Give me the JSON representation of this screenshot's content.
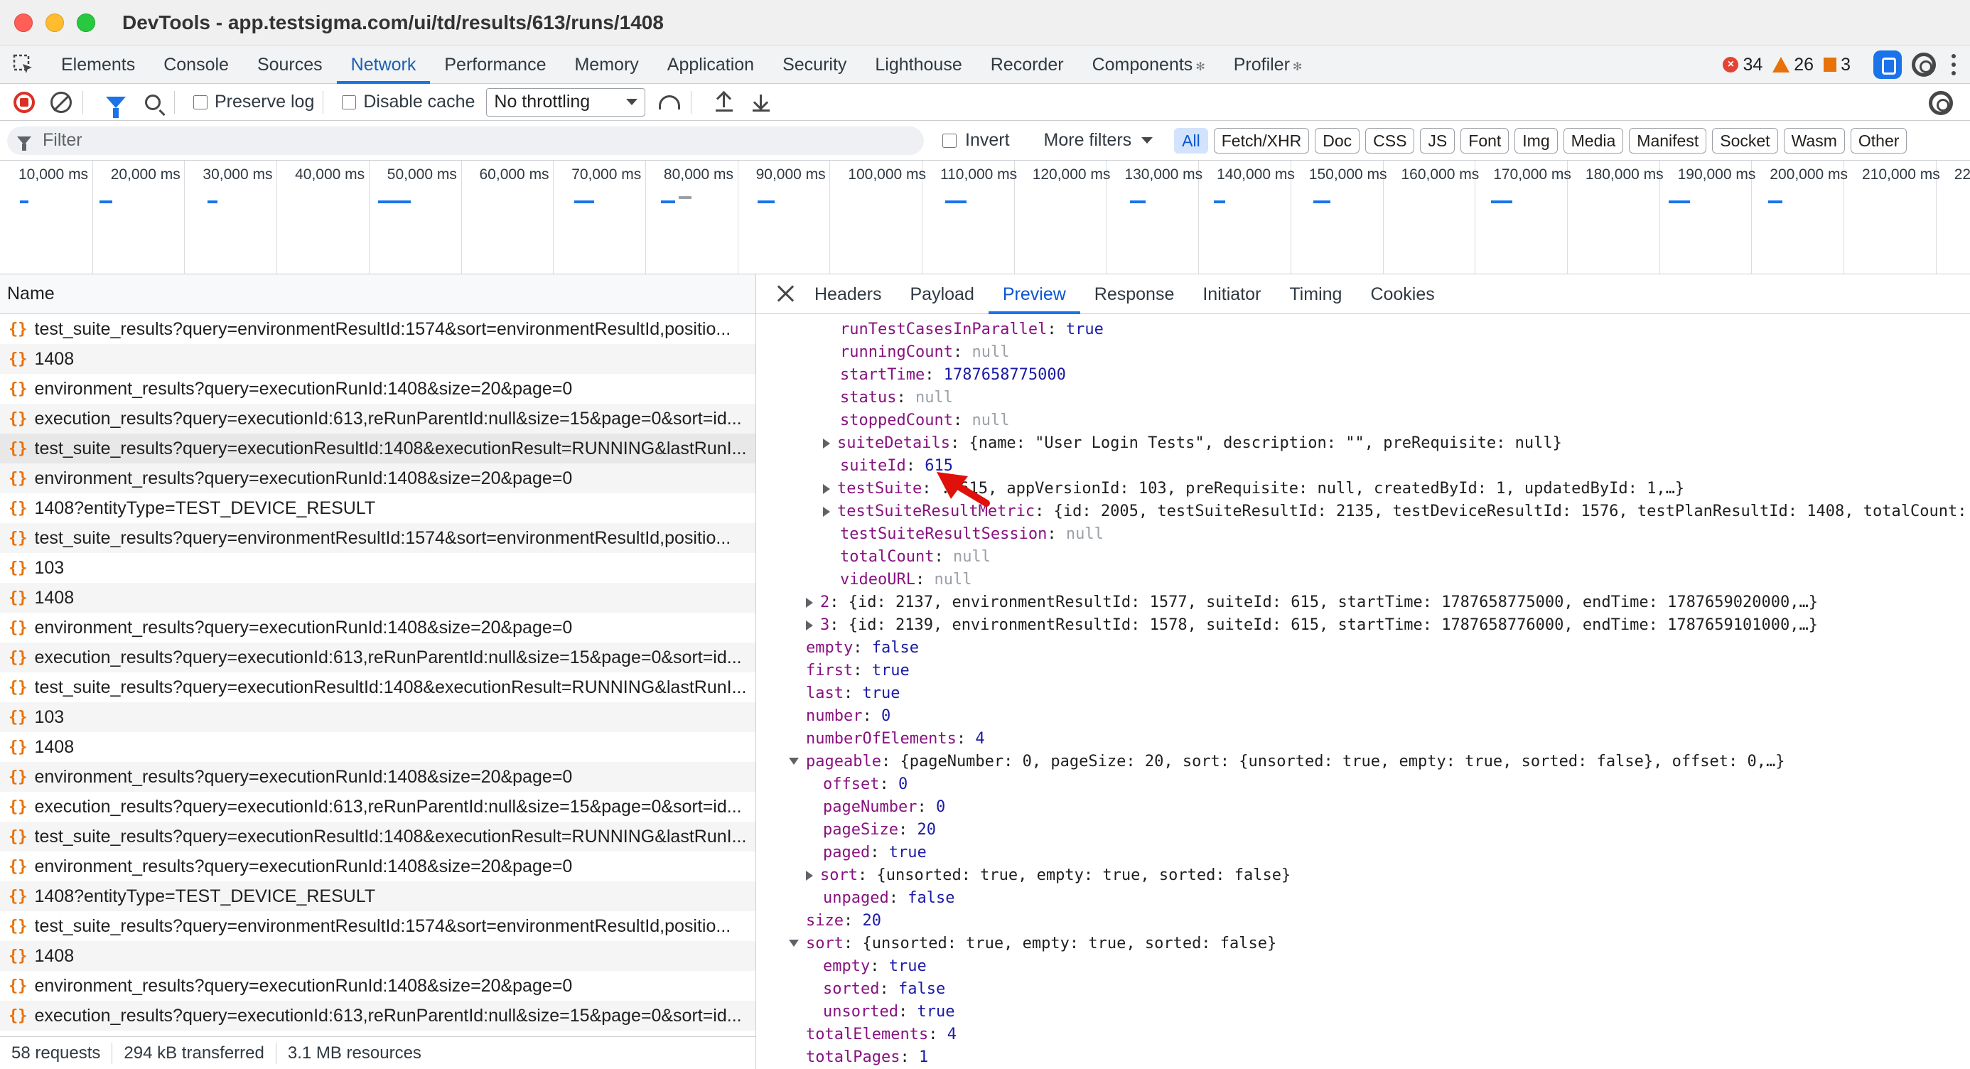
{
  "window": {
    "title": "DevTools - app.testsigma.com/ui/td/results/613/runs/1408"
  },
  "tabs": [
    {
      "label": "Elements",
      "active": false,
      "star": false
    },
    {
      "label": "Console",
      "active": false,
      "star": false
    },
    {
      "label": "Sources",
      "active": false,
      "star": false
    },
    {
      "label": "Network",
      "active": true,
      "star": false
    },
    {
      "label": "Performance",
      "active": false,
      "star": false
    },
    {
      "label": "Memory",
      "active": false,
      "star": false
    },
    {
      "label": "Application",
      "active": false,
      "star": false
    },
    {
      "label": "Security",
      "active": false,
      "star": false
    },
    {
      "label": "Lighthouse",
      "active": false,
      "star": false
    },
    {
      "label": "Recorder",
      "active": false,
      "star": false
    },
    {
      "label": "Components",
      "active": false,
      "star": true
    },
    {
      "label": "Profiler",
      "active": false,
      "star": true
    }
  ],
  "counts": {
    "errors": "34",
    "warnings": "26",
    "issues": "3"
  },
  "toolbar": {
    "preserve_log": "Preserve log",
    "disable_cache": "Disable cache",
    "throttling": "No throttling"
  },
  "filterbar": {
    "placeholder": "Filter",
    "invert": "Invert",
    "more_filters": "More filters",
    "chips": [
      "All",
      "Fetch/XHR",
      "Doc",
      "CSS",
      "JS",
      "Font",
      "Img",
      "Media",
      "Manifest",
      "Socket",
      "Wasm",
      "Other"
    ],
    "active_chip": "All"
  },
  "overview": {
    "labels": [
      "10,000 ms",
      "20,000 ms",
      "30,000 ms",
      "40,000 ms",
      "50,000 ms",
      "60,000 ms",
      "70,000 ms",
      "80,000 ms",
      "90,000 ms",
      "100,000 ms",
      "110,000 ms",
      "120,000 ms",
      "130,000 ms",
      "140,000 ms",
      "150,000 ms",
      "160,000 ms",
      "170,000 ms",
      "180,000 ms",
      "190,000 ms",
      "200,000 ms",
      "210,000 ms",
      "22"
    ]
  },
  "requests": {
    "header": "Name",
    "rows": [
      "test_suite_results?query=environmentResultId:1574&sort=environmentResultId,positio...",
      "1408",
      "environment_results?query=executionRunId:1408&size=20&page=0",
      "execution_results?query=executionId:613,reRunParentId:null&size=15&page=0&sort=id...",
      "test_suite_results?query=executionResultId:1408&executionResult=RUNNING&lastRunI...",
      "environment_results?query=executionRunId:1408&size=20&page=0",
      "1408?entityType=TEST_DEVICE_RESULT",
      "test_suite_results?query=environmentResultId:1574&sort=environmentResultId,positio...",
      "103",
      "1408",
      "environment_results?query=executionRunId:1408&size=20&page=0",
      "execution_results?query=executionId:613,reRunParentId:null&size=15&page=0&sort=id...",
      "test_suite_results?query=executionResultId:1408&executionResult=RUNNING&lastRunI...",
      "103",
      "1408",
      "environment_results?query=executionRunId:1408&size=20&page=0",
      "execution_results?query=executionId:613,reRunParentId:null&size=15&page=0&sort=id...",
      "test_suite_results?query=executionResultId:1408&executionResult=RUNNING&lastRunI...",
      "environment_results?query=executionRunId:1408&size=20&page=0",
      "1408?entityType=TEST_DEVICE_RESULT",
      "test_suite_results?query=environmentResultId:1574&sort=environmentResultId,positio...",
      "1408",
      "environment_results?query=executionRunId:1408&size=20&page=0",
      "execution_results?query=executionId:613,reRunParentId:null&size=15&page=0&sort=id..."
    ],
    "selected_index": 4
  },
  "status": {
    "requests": "58 requests",
    "transferred": "294 kB transferred",
    "resources": "3.1 MB resources"
  },
  "detail_tabs": [
    {
      "label": "Headers",
      "active": false
    },
    {
      "label": "Payload",
      "active": false
    },
    {
      "label": "Preview",
      "active": true
    },
    {
      "label": "Response",
      "active": false
    },
    {
      "label": "Initiator",
      "active": false
    },
    {
      "label": "Timing",
      "active": false
    },
    {
      "label": "Cookies",
      "active": false
    }
  ],
  "preview_lines": [
    {
      "indent": 2,
      "toggle": "",
      "key": "runTestCasesInParallel",
      "value": "true",
      "type": "b"
    },
    {
      "indent": 2,
      "toggle": "",
      "key": "runningCount",
      "value": "null",
      "type": "nul"
    },
    {
      "indent": 2,
      "toggle": "",
      "key": "startTime",
      "value": "1787658775000",
      "type": "n"
    },
    {
      "indent": 2,
      "toggle": "",
      "key": "status",
      "value": "null",
      "type": "nul"
    },
    {
      "indent": 2,
      "toggle": "",
      "key": "stoppedCount",
      "value": "null",
      "type": "nul"
    },
    {
      "indent": 2,
      "toggle": "r",
      "key": "suiteDetails",
      "value": "{name: \"User Login Tests\", description: \"\", preRequisite: null}",
      "type": "p"
    },
    {
      "indent": 2,
      "toggle": "",
      "key": "suiteId",
      "value": "615",
      "type": "n"
    },
    {
      "indent": 2,
      "toggle": "r",
      "key": "testSuite",
      "value": "  : 615, appVersionId: 103, preRequisite: null, createdById: 1, updatedById: 1,…}",
      "type": "p"
    },
    {
      "indent": 2,
      "toggle": "r",
      "key": "testSuiteResultMetric",
      "value": "{id: 2005, testSuiteResultId: 2135, testDeviceResultId: 1576, testPlanResultId: 1408, totalCount:",
      "type": "p"
    },
    {
      "indent": 2,
      "toggle": "",
      "key": "testSuiteResultSession",
      "value": "null",
      "type": "nul"
    },
    {
      "indent": 2,
      "toggle": "",
      "key": "totalCount",
      "value": "null",
      "type": "nul"
    },
    {
      "indent": 2,
      "toggle": "",
      "key": "videoURL",
      "value": "null",
      "type": "nul"
    },
    {
      "indent": 1,
      "toggle": "r",
      "key": "2",
      "value": "{id: 2137, environmentResultId: 1577, suiteId: 615, startTime: 1787658775000, endTime: 1787659020000,…}",
      "type": "p"
    },
    {
      "indent": 1,
      "toggle": "r",
      "key": "3",
      "value": "{id: 2139, environmentResultId: 1578, suiteId: 615, startTime: 1787658776000, endTime: 1787659101000,…}",
      "type": "p"
    },
    {
      "indent": 0,
      "toggle": "",
      "key": "empty",
      "value": "false",
      "type": "b"
    },
    {
      "indent": 0,
      "toggle": "",
      "key": "first",
      "value": "true",
      "type": "b"
    },
    {
      "indent": 0,
      "toggle": "",
      "key": "last",
      "value": "true",
      "type": "b"
    },
    {
      "indent": 0,
      "toggle": "",
      "key": "number",
      "value": "0",
      "type": "n"
    },
    {
      "indent": 0,
      "toggle": "",
      "key": "numberOfElements",
      "value": "4",
      "type": "n"
    },
    {
      "indent": 0,
      "toggle": "d",
      "key": "pageable",
      "value": "{pageNumber: 0, pageSize: 20, sort: {unsorted: true, empty: true, sorted: false}, offset: 0,…}",
      "type": "p"
    },
    {
      "indent": 1,
      "toggle": "",
      "key": "offset",
      "value": "0",
      "type": "n"
    },
    {
      "indent": 1,
      "toggle": "",
      "key": "pageNumber",
      "value": "0",
      "type": "n"
    },
    {
      "indent": 1,
      "toggle": "",
      "key": "pageSize",
      "value": "20",
      "type": "n"
    },
    {
      "indent": 1,
      "toggle": "",
      "key": "paged",
      "value": "true",
      "type": "b"
    },
    {
      "indent": 1,
      "toggle": "r",
      "key": "sort",
      "value": "{unsorted: true, empty: true, sorted: false}",
      "type": "p"
    },
    {
      "indent": 1,
      "toggle": "",
      "key": "unpaged",
      "value": "false",
      "type": "b"
    },
    {
      "indent": 0,
      "toggle": "",
      "key": "size",
      "value": "20",
      "type": "n"
    },
    {
      "indent": 0,
      "toggle": "d",
      "key": "sort",
      "value": "{unsorted: true, empty: true, sorted: false}",
      "type": "p"
    },
    {
      "indent": 1,
      "toggle": "",
      "key": "empty",
      "value": "true",
      "type": "b"
    },
    {
      "indent": 1,
      "toggle": "",
      "key": "sorted",
      "value": "false",
      "type": "b"
    },
    {
      "indent": 1,
      "toggle": "",
      "key": "unsorted",
      "value": "true",
      "type": "b"
    },
    {
      "indent": 0,
      "toggle": "",
      "key": "totalElements",
      "value": "4",
      "type": "n"
    },
    {
      "indent": 0,
      "toggle": "",
      "key": "totalPages",
      "value": "1",
      "type": "n"
    }
  ]
}
